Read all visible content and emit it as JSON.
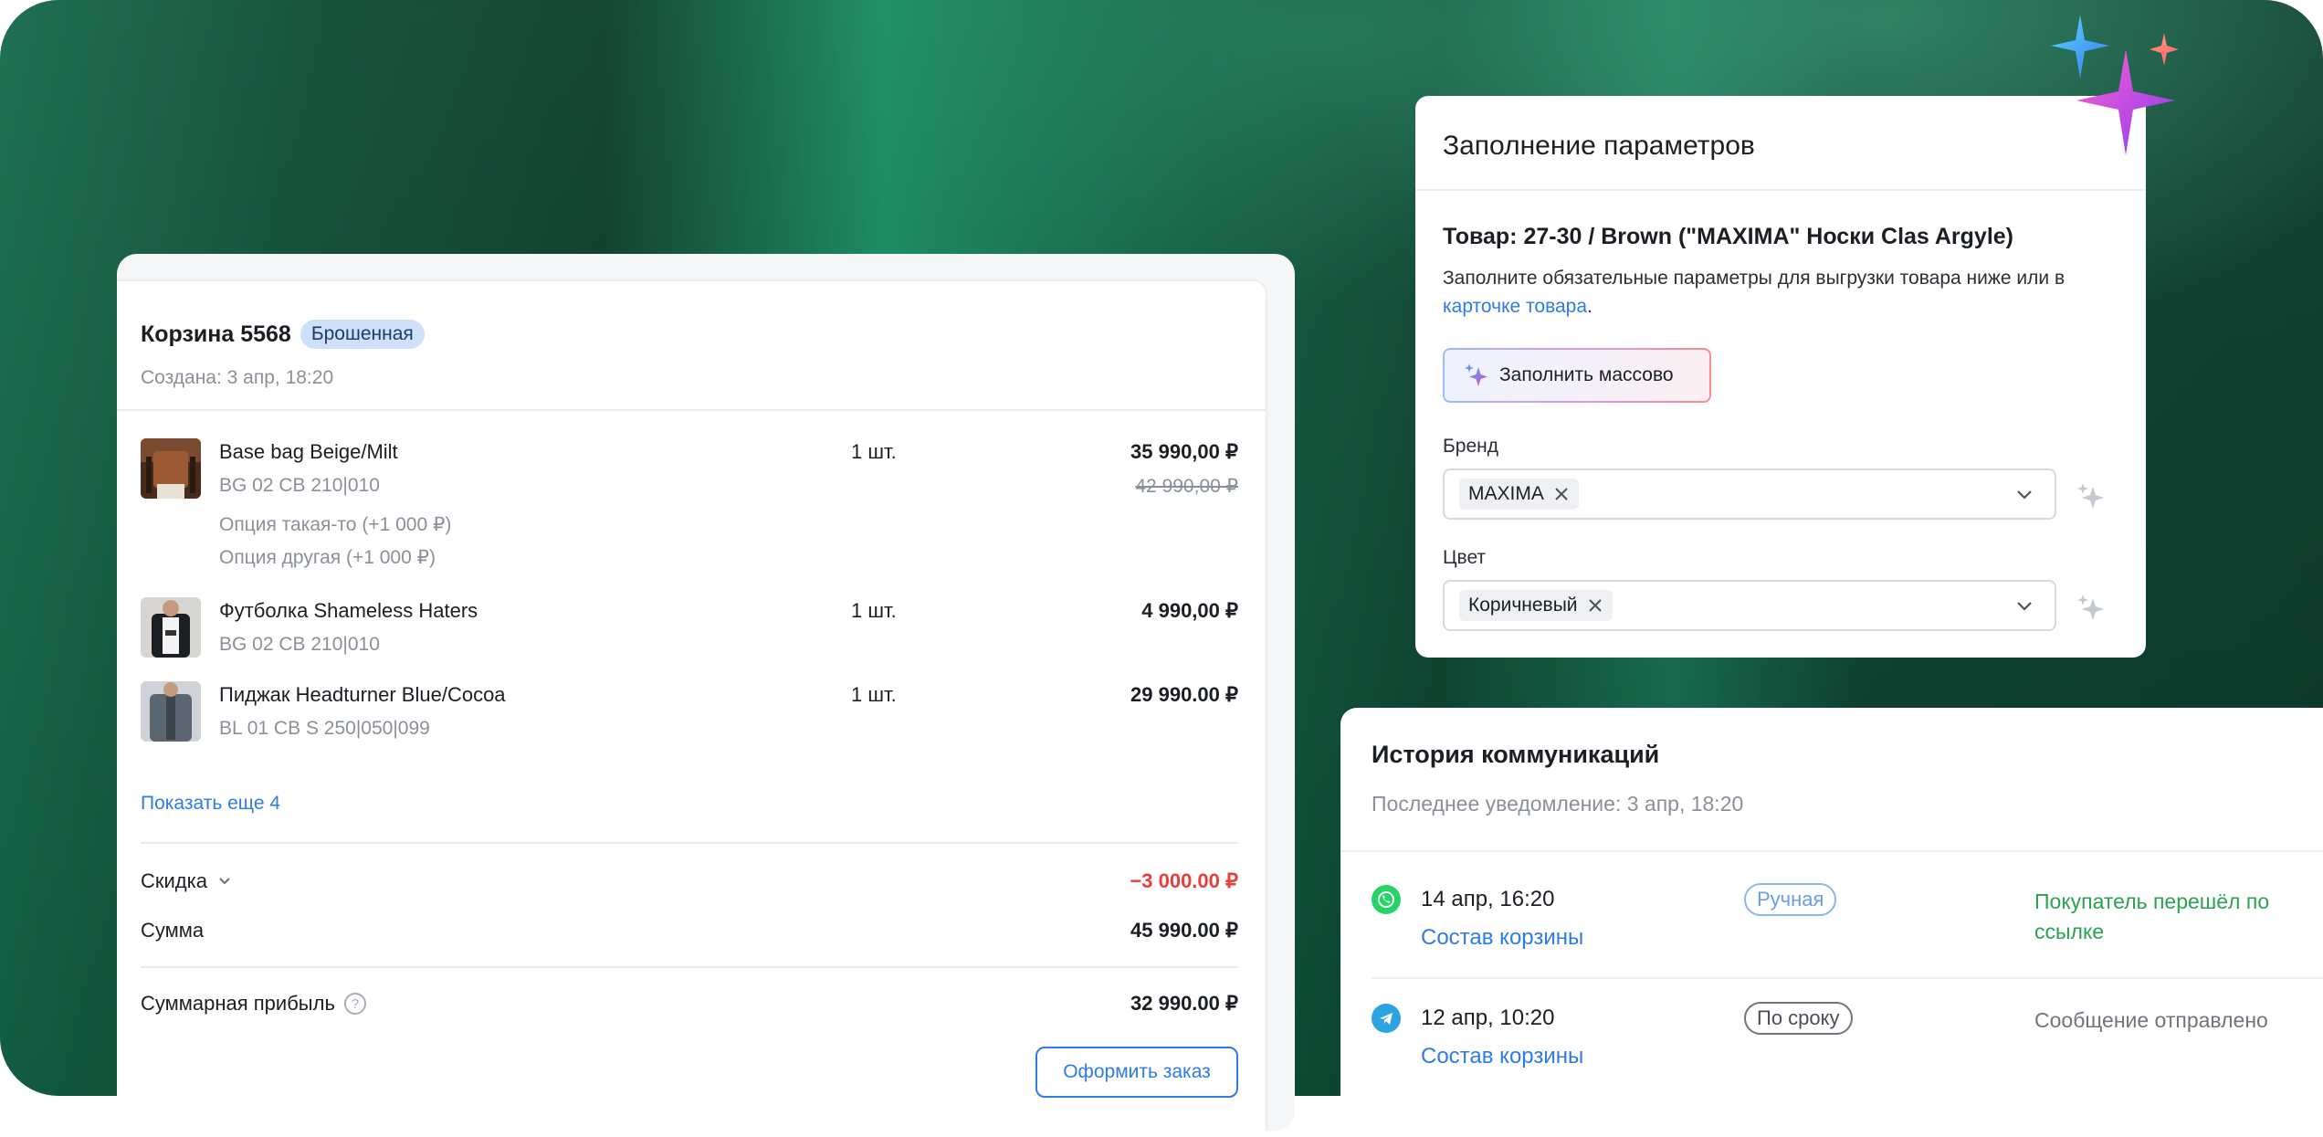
{
  "cart": {
    "title": "Корзина 5568",
    "badge": "Брошенная",
    "created": "Создана: 3 апр, 18:20",
    "items": [
      {
        "name": "Base bag Beige/Milt",
        "sku": "BG 02 CB 210|010",
        "qty": "1 шт.",
        "price": "35 990,00 ₽",
        "old_price": "42 990,00 ₽",
        "options": [
          "Опция такая-то (+1 000 ₽)",
          "Опция другая (+1 000 ₽)"
        ]
      },
      {
        "name": "Футболка Shameless Haters",
        "sku": "BG 02 CB 210|010",
        "qty": "1 шт.",
        "price": "4 990,00 ₽"
      },
      {
        "name": "Пиджак Headturner Blue/Cocoa",
        "sku": "BL 01 CB S 250|050|099",
        "qty": "1 шт.",
        "price": "29 990.00 ₽"
      }
    ],
    "show_more": "Показать еще 4",
    "discount_label": "Скидка",
    "discount_value": "−3 000.00 ₽",
    "sum_label": "Сумма",
    "sum_value": "45 990.00 ₽",
    "profit_label": "Суммарная прибыль",
    "profit_value": "32 990.00 ₽",
    "help_glyph": "?",
    "order_button": "Оформить заказ"
  },
  "params": {
    "title": "Заполнение параметров",
    "product": "Товар: 27-30 / Brown (\"MAXIMA\" Носки Clas Argyle)",
    "desc_text": "Заполните обязательные параметры для выгрузки товара ниже или в ",
    "desc_link": "карточке товара",
    "desc_end": ".",
    "fill_button": "Заполнить массово",
    "brand_label": "Бренд",
    "brand_value": "MAXIMA",
    "color_label": "Цвет",
    "color_value": "Коричневый"
  },
  "history": {
    "title": "История коммуникаций",
    "subtitle": "Последнее уведомление: 3 апр, 18:20",
    "rows": [
      {
        "channel_icon": "whatsapp-icon",
        "date": "14 апр, 16:20",
        "link": "Состав корзины",
        "tag": "Ручная",
        "status": "Покупатель перешёл по ссылке"
      },
      {
        "channel_icon": "telegram-icon",
        "date": "12 апр, 10:20",
        "link": "Состав корзины",
        "tag": "По сроку",
        "status": "Сообщение отправлено"
      }
    ]
  },
  "colors": {
    "accent": "#2f7be5",
    "success": "#2aa24f",
    "danger": "#e5413a",
    "badge_bg": "#cfe0fb"
  }
}
